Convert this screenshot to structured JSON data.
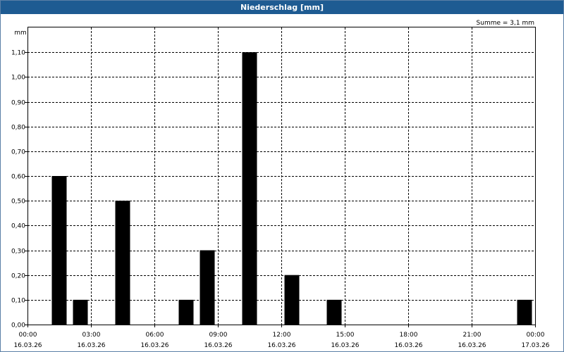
{
  "window": {
    "title": "Niederschlag [mm]"
  },
  "chart_data": {
    "type": "bar",
    "title": "Niederschlag [mm]",
    "annotation": "Summe = 3,1 mm",
    "ylabel": "mm",
    "ylim": [
      0,
      1.2
    ],
    "xlim": [
      "16.03.26 00:00",
      "17.03.26 00:00"
    ],
    "y_ticks": [
      "0,00",
      "0,10",
      "0,20",
      "0,30",
      "0,40",
      "0,50",
      "0,60",
      "0,70",
      "0,80",
      "0,90",
      "1,00",
      "1,10"
    ],
    "x_ticks": [
      {
        "time": "00:00",
        "date": "16.03.26"
      },
      {
        "time": "03:00",
        "date": "16.03.26"
      },
      {
        "time": "06:00",
        "date": "16.03.26"
      },
      {
        "time": "09:00",
        "date": "16.03.26"
      },
      {
        "time": "12:00",
        "date": "16.03.26"
      },
      {
        "time": "15:00",
        "date": "16.03.26"
      },
      {
        "time": "18:00",
        "date": "16.03.26"
      },
      {
        "time": "21:00",
        "date": "16.03.26"
      },
      {
        "time": "00:00",
        "date": "17.03.26"
      }
    ],
    "interval": "1 h",
    "categories": [
      "16.03.26 00:00-01:00",
      "16.03.26 01:00-02:00",
      "16.03.26 02:00-03:00",
      "16.03.26 03:00-04:00",
      "16.03.26 04:00-05:00",
      "16.03.26 05:00-06:00",
      "16.03.26 06:00-07:00",
      "16.03.26 07:00-08:00",
      "16.03.26 08:00-09:00",
      "16.03.26 09:00-10:00",
      "16.03.26 10:00-11:00",
      "16.03.26 11:00-12:00",
      "16.03.26 12:00-13:00",
      "16.03.26 13:00-14:00",
      "16.03.26 14:00-15:00",
      "16.03.26 15:00-16:00",
      "16.03.26 16:00-17:00",
      "16.03.26 17:00-18:00",
      "16.03.26 18:00-19:00",
      "16.03.26 19:00-20:00",
      "16.03.26 20:00-21:00",
      "16.03.26 21:00-22:00",
      "16.03.26 22:00-23:00",
      "16.03.26 23:00-24:00"
    ],
    "values": [
      0,
      0.6,
      0.1,
      0,
      0.5,
      0,
      0,
      0.1,
      0.3,
      0,
      1.1,
      0,
      0.2,
      0,
      0.1,
      0,
      0,
      0,
      0,
      0,
      0,
      0,
      0,
      0.1
    ],
    "grid": true,
    "colors": {
      "bar": "#000000",
      "titlebar": "#1e5b92",
      "grid": "#000000"
    }
  }
}
